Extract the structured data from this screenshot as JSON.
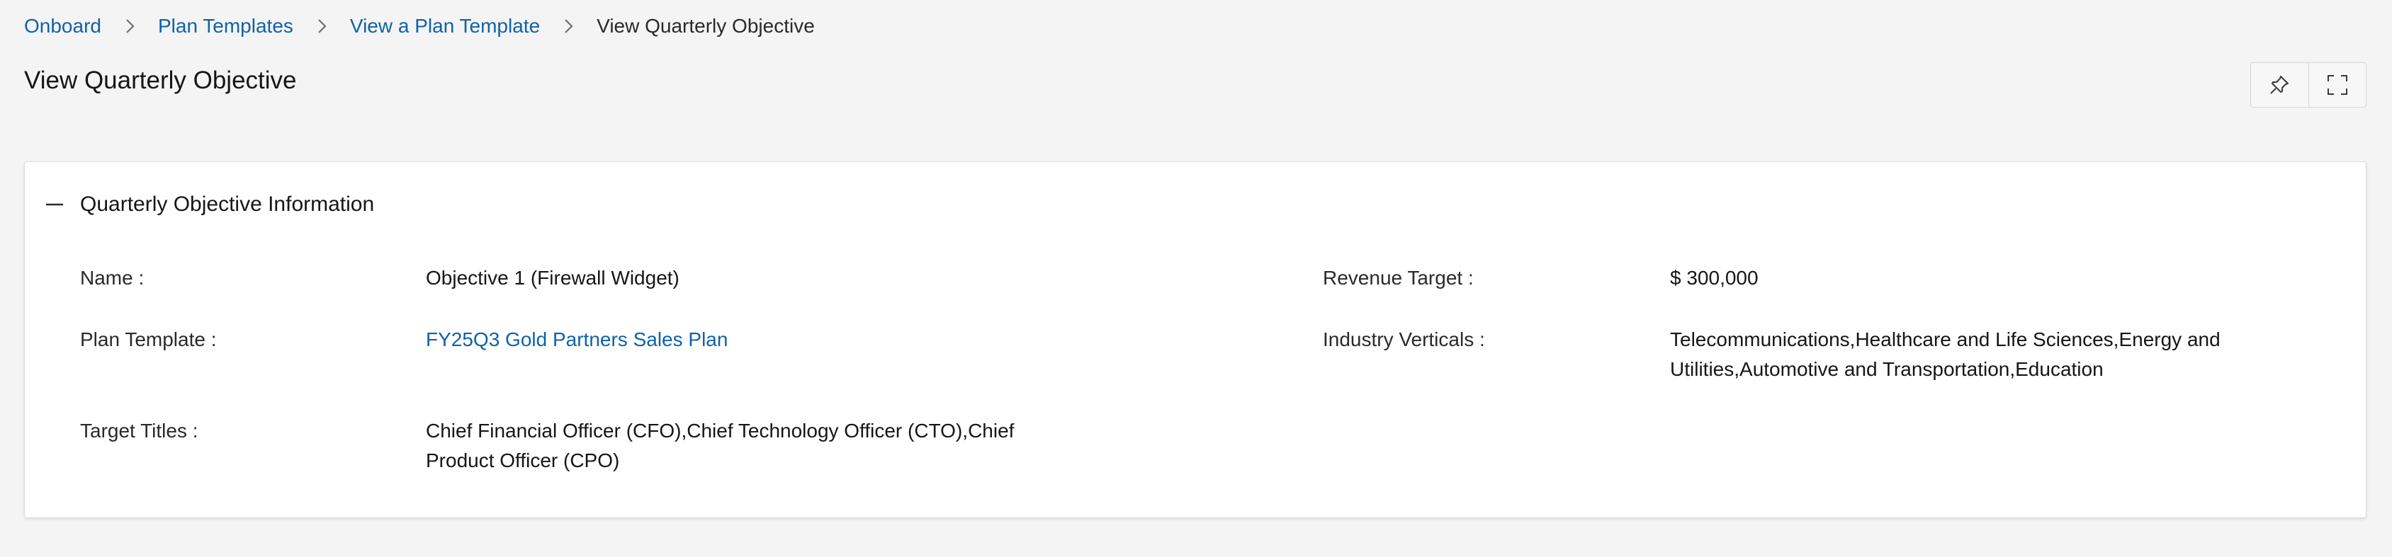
{
  "breadcrumb": {
    "items": [
      "Onboard",
      "Plan Templates",
      "View a Plan Template"
    ],
    "current": "View Quarterly Objective"
  },
  "page": {
    "title": "View Quarterly Objective"
  },
  "toolbar": {
    "icons": [
      "pin-icon",
      "fullscreen-icon"
    ]
  },
  "section": {
    "title": "Quarterly Objective Information",
    "icon": "minus-icon"
  },
  "fields": {
    "name": {
      "label": "Name :",
      "value": "Objective 1 (Firewall Widget)"
    },
    "revenue_target": {
      "label": "Revenue Target :",
      "value": "$ 300,000"
    },
    "plan_template": {
      "label": "Plan Template :",
      "value": "FY25Q3 Gold Partners Sales Plan"
    },
    "industry_verticals": {
      "label": "Industry Verticals :",
      "value_line1": "Telecommunications,Healthcare and Life Sciences,Energy and",
      "value_line2": "Utilities,Automotive and Transportation,Education"
    },
    "target_titles": {
      "label": "Target Titles :",
      "value_line1": "Chief Financial Officer (CFO),Chief Technology Officer (CTO),Chief",
      "value_line2": "Product Officer (CPO)"
    }
  },
  "colors": {
    "link": "#0f62a8",
    "background": "#f4f4f4",
    "card": "#ffffff"
  }
}
